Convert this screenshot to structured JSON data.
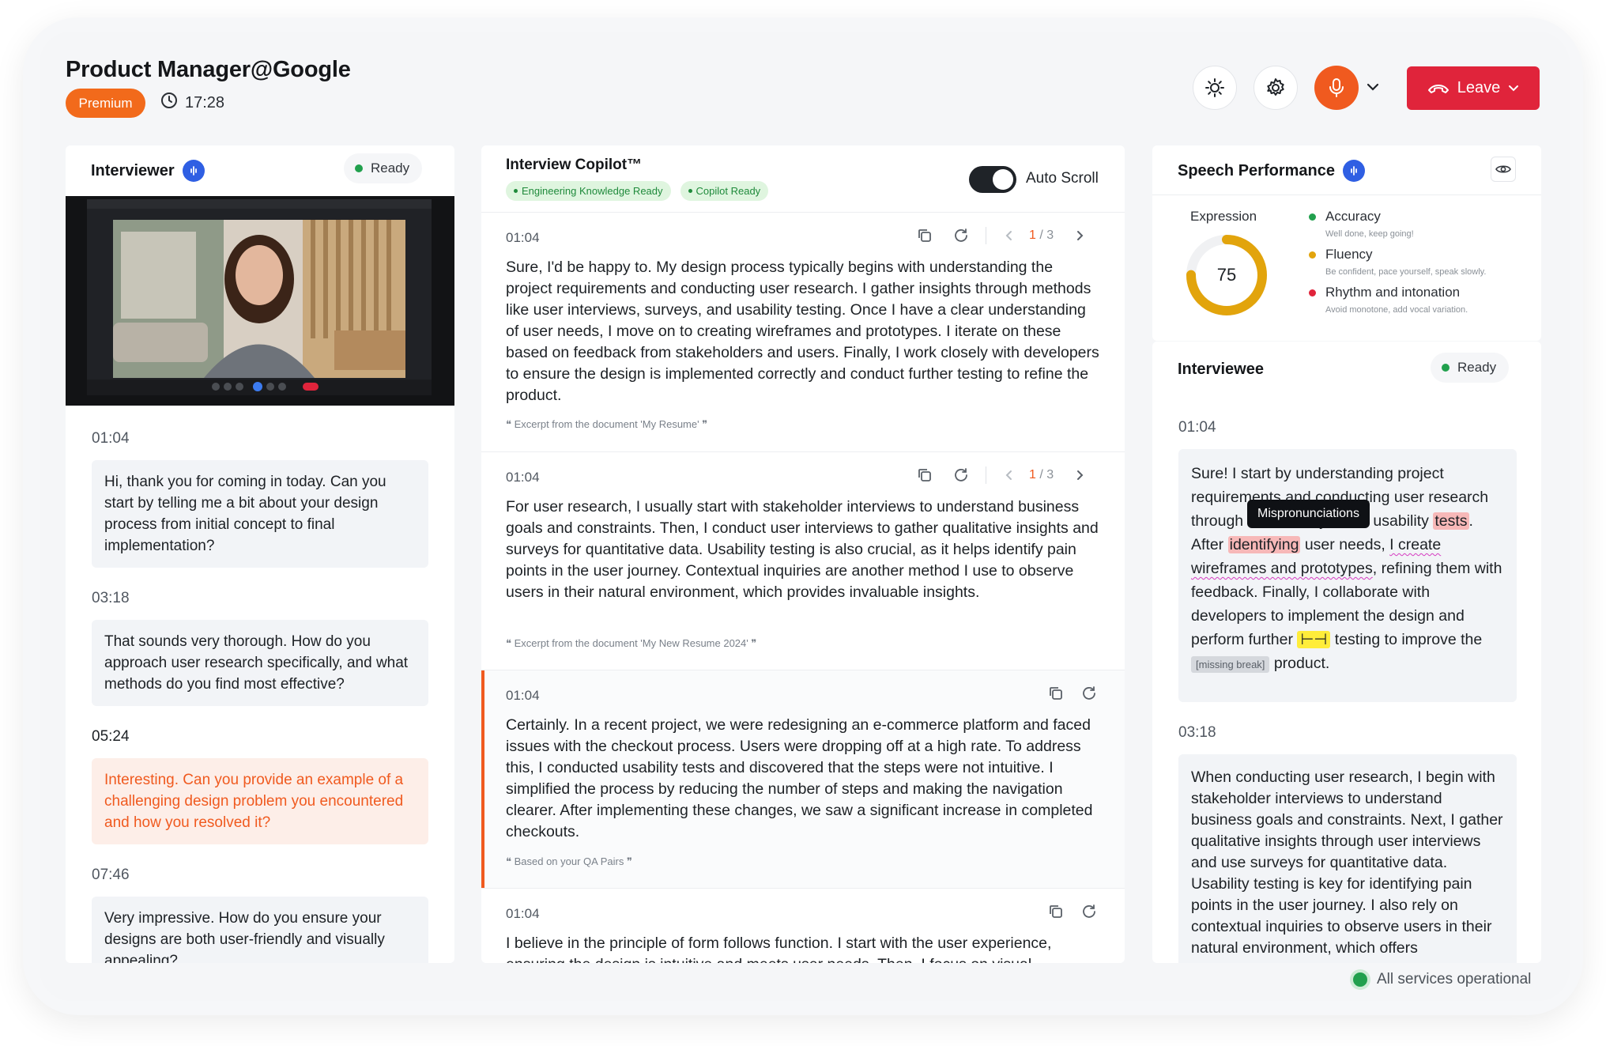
{
  "header": {
    "title": "Product Manager@Google",
    "plan_badge": "Premium",
    "timer": "17:28",
    "leave_label": "Leave"
  },
  "interviewer": {
    "title": "Interviewer",
    "status": "Ready",
    "messages": [
      {
        "time": "01:04",
        "text": "Hi, thank you for coming in today. Can you start by telling me a bit about your design process from initial concept to final implementation?"
      },
      {
        "time": "03:18",
        "text": "That sounds very thorough. How do you approach user research specifically, and what methods do you find most effective?"
      },
      {
        "time": "05:24",
        "text": "Interesting. Can you provide an example of a challenging design problem you encountered and how you resolved it?"
      },
      {
        "time": "07:46",
        "text": "Very impressive. How do you ensure your designs are both user-friendly and visually appealing?"
      }
    ]
  },
  "copilot": {
    "title": "Interview Copilot™",
    "tags": [
      "Engineering Knowledge Ready",
      "Copilot Ready"
    ],
    "auto_scroll_label": "Auto Scroll",
    "cards": [
      {
        "time": "01:04",
        "page": "1",
        "total": "/ 3",
        "text": "Sure, I'd be happy to. My design process typically begins with understanding the project requirements and conducting user research. I gather insights through methods like user interviews, surveys, and usability testing. Once I have a clear understanding of user needs, I move on to creating wireframes and prototypes. I iterate on these based on feedback from stakeholders and users. Finally, I work closely with developers to ensure the design is implemented correctly and conduct further testing to refine the product.",
        "source": "Excerpt from the document 'My Resume'"
      },
      {
        "time": "01:04",
        "page": "1",
        "total": "/ 3",
        "text": "For user research, I usually start with stakeholder interviews to understand business goals and constraints. Then, I conduct user interviews to gather qualitative insights and surveys for quantitative data. Usability testing is also crucial, as it helps identify pain points in the user journey. Contextual inquiries are another method I use to observe users in their natural environment, which provides invaluable insights.",
        "source": "Excerpt from the document 'My New Resume 2024'"
      },
      {
        "time": "01:04",
        "text": "Certainly. In a recent project, we were redesigning an e-commerce platform and faced issues with the checkout process. Users were dropping off at a high rate. To address this, I conducted usability tests and discovered that the steps were not intuitive. I simplified the process by reducing the number of steps and making the navigation clearer. After implementing these changes, we saw a significant increase in completed checkouts.",
        "source": "Based on your QA Pairs"
      },
      {
        "time": "01:04",
        "text": "I believe in the principle of form follows function. I start with the user experience, ensuring the design is intuitive and meets user needs. Then, I focus on visual"
      }
    ]
  },
  "speech": {
    "title": "Speech Performance",
    "expression_label": "Expression",
    "score": "75",
    "score_value": 75,
    "metrics": [
      {
        "name": "Accuracy",
        "hint": "Well done, keep going!",
        "color": "#21a04d"
      },
      {
        "name": "Fluency",
        "hint": "Be confident, pace yourself, speak slowly.",
        "color": "#e2a40c"
      },
      {
        "name": "Rhythm and intonation",
        "hint": "Avoid monotone, add vocal variation.",
        "color": "#e0243b"
      }
    ]
  },
  "interviewee": {
    "title": "Interviewee",
    "status": "Ready",
    "tooltip": "Mispronunciations",
    "first": {
      "time": "01:04",
      "p1": "Sure! I start by understanding project requirements and conducting user research through",
      "p2": "ys, and usability",
      "w_tests": "tests",
      "p3": ". After ",
      "w_identifying": "identifying",
      "p4": " user needs, ",
      "w_create": "I create wireframes and prototypes",
      "p5": ", refining them with feedback. Finally, I collaborate with developers to implement the design and perform further ",
      "w_filler": "⊢⊣",
      "p6": " testing to improve the ",
      "missing": "[missing break]",
      "p7": " product."
    },
    "second": {
      "time": "03:18",
      "text": "When conducting user research, I begin with stakeholder interviews to understand business goals and constraints. Next, I gather qualitative insights through user interviews and use surveys for quantitative data. Usability testing is key for identifying pain points in the user journey. I also rely on contextual inquiries to observe users in their natural environment, which offers"
    }
  },
  "footer": {
    "status": "All services operational"
  },
  "colors": {
    "accent": "#f05a1f",
    "leave": "#e0243b",
    "brand_blue": "#2f5fe3",
    "ok_green": "#21a04d"
  }
}
